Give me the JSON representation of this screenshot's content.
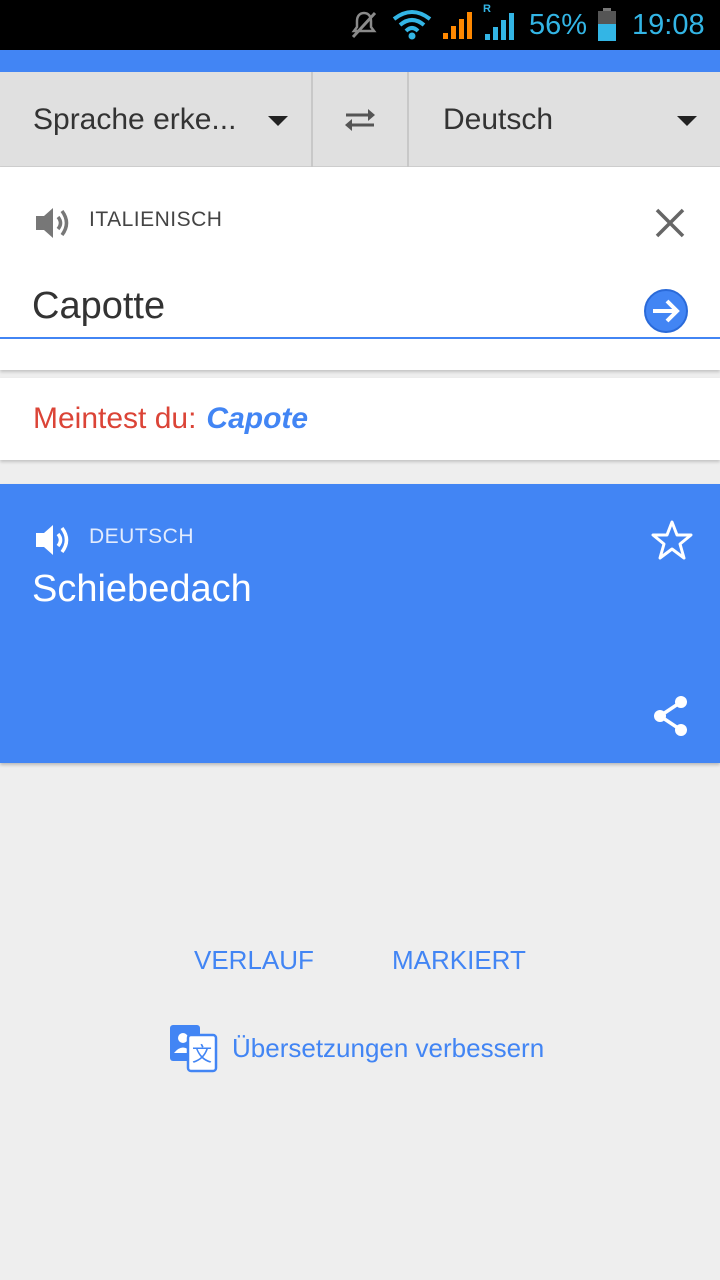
{
  "status_bar": {
    "battery": "56%",
    "time": "19:08",
    "roaming_indicator": "R",
    "icons": [
      "mute-icon",
      "wifi-icon",
      "signal-icon",
      "signal-roaming-icon",
      "battery-icon"
    ]
  },
  "language_bar": {
    "source_label": "Sprache erke...",
    "target_label": "Deutsch",
    "swap_icon": "swap-arrows-icon"
  },
  "input_card": {
    "detected_language": "ITALIENISCH",
    "text": "Capotte",
    "speaker_icon": "speaker-icon",
    "clear_icon": "close-icon",
    "translate_icon": "arrow-right-circle-icon"
  },
  "suggestion": {
    "prefix": "Meintest du:",
    "word": "Capote"
  },
  "result_card": {
    "language": "DEUTSCH",
    "text": "Schiebedach",
    "speaker_icon": "speaker-icon",
    "star_icon": "star-icon",
    "share_icon": "share-icon"
  },
  "footer": {
    "history": "VERLAUF",
    "starred": "MARKIERT",
    "improve": "Übersetzungen verbessern",
    "improve_icon": "translate-community-icon"
  },
  "colors": {
    "accent": "#4285f4",
    "suggestion_prefix": "#db4437",
    "status_bar_text": "#33b5e5",
    "background": "#eeeeee"
  }
}
